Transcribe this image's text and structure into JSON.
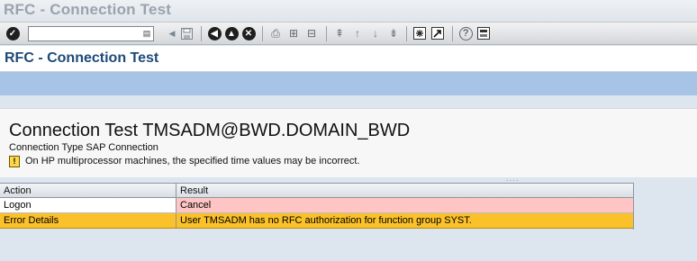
{
  "window": {
    "title": "RFC - Connection Test"
  },
  "toolbar": {
    "command_value": "",
    "icons": [
      "enter-icon",
      "back-icon",
      "save-icon",
      "back-nav-icon",
      "exit-icon",
      "cancel-icon",
      "print-icon",
      "find-icon",
      "find-next-icon",
      "first-page-icon",
      "prev-page-icon",
      "next-page-icon",
      "last-page-icon",
      "new-session-icon",
      "shortcut-icon",
      "help-icon",
      "layout-icon"
    ]
  },
  "app": {
    "title": "RFC - Connection Test"
  },
  "content": {
    "heading": "Connection Test TMSADM@BWD.DOMAIN_BWD",
    "connection_type": "Connection Type SAP Connection",
    "warning": "On HP multiprocessor machines, the specified time values may be incorrect."
  },
  "table": {
    "columns": [
      "Action",
      "Result"
    ],
    "rows": [
      {
        "action": "Logon",
        "result": "Cancel",
        "status": "error"
      },
      {
        "action": "Error Details",
        "result": "User TMSADM has no RFC authorization for function group SYST.",
        "status": "warning"
      }
    ]
  },
  "colors": {
    "app_title": "#1e4a78",
    "app_bar": "#a7c4e6",
    "error_cell": "#ffc4c4",
    "warning_row": "#fbc12b"
  }
}
